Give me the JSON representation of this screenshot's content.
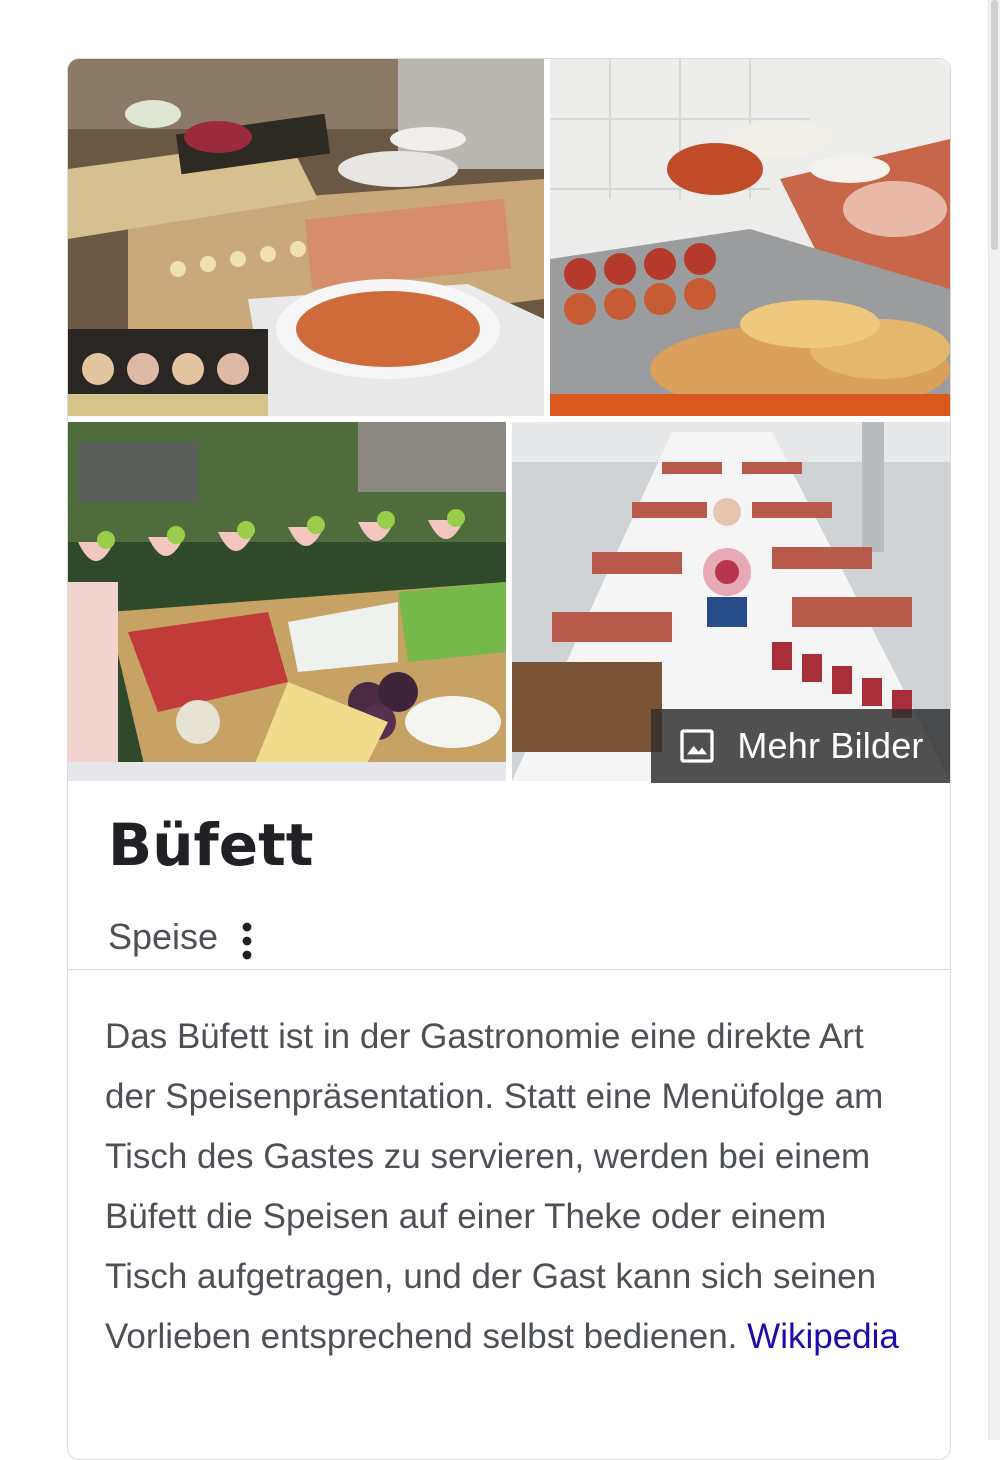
{
  "gallery": {
    "images": [
      {
        "alt": "buffet-table-photo"
      },
      {
        "alt": "buffet-platters-photo"
      },
      {
        "alt": "fruit-cheese-buffet-photo"
      },
      {
        "alt": "long-buffet-table-photo"
      }
    ],
    "more_images_label": "Mehr Bilder",
    "more_images_icon": "image-icon"
  },
  "entity": {
    "title": "Büfett",
    "subtitle": "Speise",
    "menu_icon": "more-vert-icon"
  },
  "description": {
    "text": "Das Büfett ist in der Gastronomie eine direkte Art der Speisenpräsentation. Statt eine Menüfolge am Tisch des Gastes zu servieren, werden bei einem Büfett die Speisen auf einer Theke oder einem Tisch aufgetragen, und der Gast kann sich seinen Vorlieben entsprechend selbst bedienen.",
    "source_link": "Wikipedia"
  },
  "colors": {
    "title": "#202124",
    "text": "#4d5156",
    "link": "#1a0dab",
    "border": "#dadce0",
    "overlay": "#303030"
  }
}
